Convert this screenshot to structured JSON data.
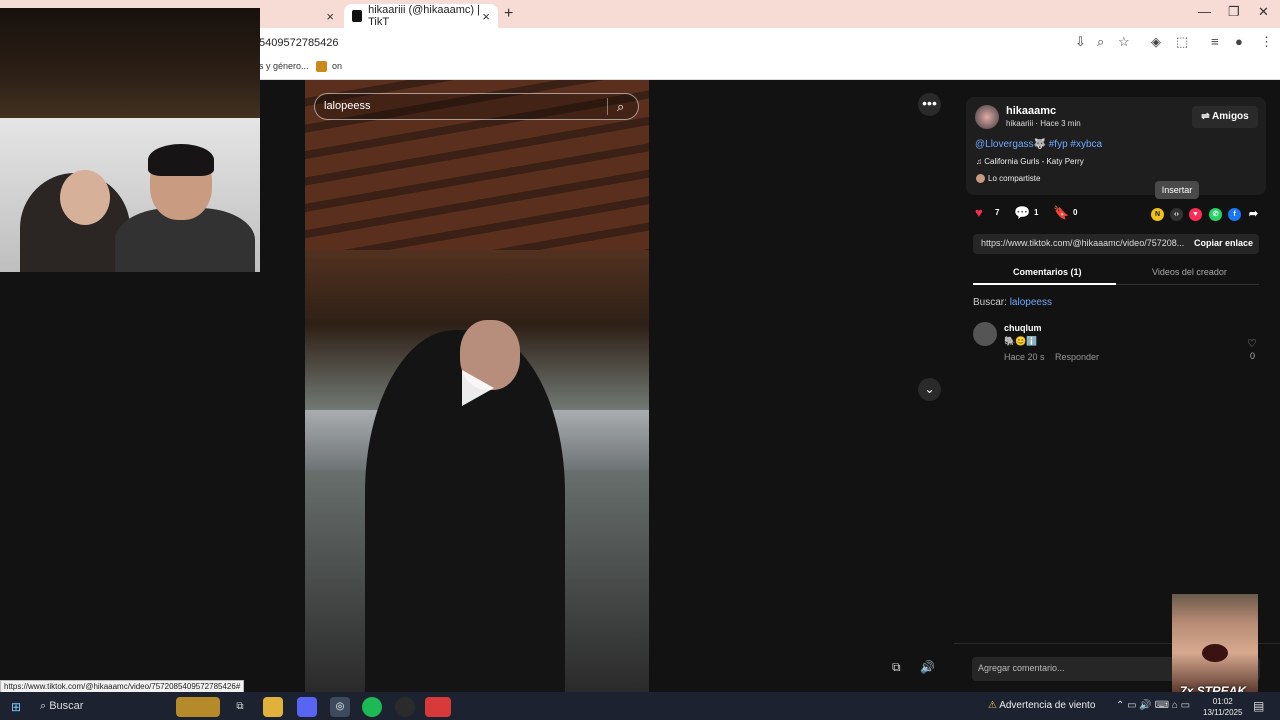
{
  "browser": {
    "tab_active_title": "hikaariii (@hikaaamc) | TikT",
    "tab_close": "×",
    "new_tab": "+",
    "url": "5409572785426",
    "bookmarks": [
      "s y género...",
      "on"
    ],
    "win_minimize": "—",
    "win_restore": "❐",
    "win_close": "✕"
  },
  "video": {
    "search_value": "lalopeess",
    "more_label": "•••",
    "down_label": "⌄",
    "pip_icon": "pip-icon",
    "volume_icon": "volume-icon"
  },
  "post": {
    "username": "hikaaamc",
    "subline": "hikaariii · Hace 3 min",
    "friends_label": "⇌ Amigos",
    "caption": "@Llovergass🐺 #fyp #xybca",
    "music": "♫  California Gurls - Katy Perry",
    "shared": "Lo compartiste",
    "likes": "7",
    "comments": "1",
    "saves": "0",
    "tooltip": "Insertar",
    "link": "https://www.tiktok.com/@hikaaamc/video/757208...",
    "copy_label": "Copiar enlace",
    "tab_comments": "Comentarios (1)",
    "tab_videos": "Videos del creador",
    "search_prefix": "Buscar:",
    "search_term": "lalopeess",
    "comment_placeholder": "Agregar comentario..."
  },
  "comment": {
    "name": "chuqlum",
    "emojis": "🐘😊ℹ️",
    "time": "Hace 20 s",
    "reply": "Responder",
    "likes": "0"
  },
  "overlay": {
    "streak": "7x STREAK",
    "status_url": "https://www.tiktok.com/@hikaaamc/video/7572085409572785426#"
  },
  "taskbar": {
    "search": "Buscar",
    "weather": "Advertencia de viento",
    "time": "01:02",
    "date": "13/11/2025"
  },
  "colors": {
    "accent_link": "#6fa8ff",
    "like_pink": "#fe2c55"
  }
}
